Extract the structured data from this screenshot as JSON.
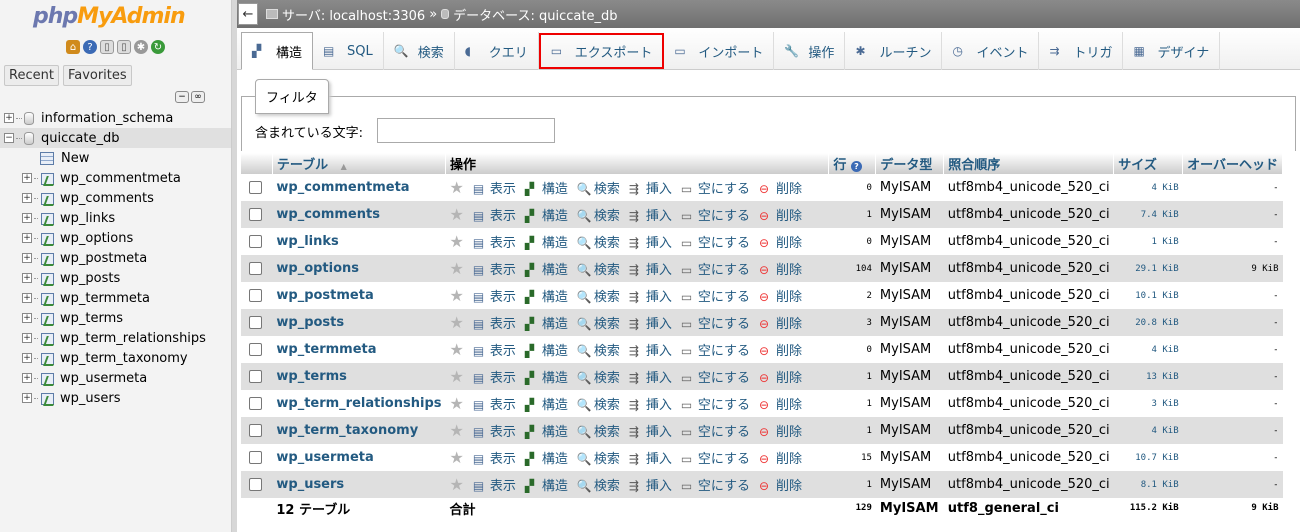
{
  "app": {
    "logo_php": "php",
    "logo_my": "MyAdmin"
  },
  "nav": {
    "recent": "Recent",
    "favorites": "Favorites",
    "tree": [
      "information_schema",
      "quiccate_db",
      "New",
      "wp_commentmeta",
      "wp_comments",
      "wp_links",
      "wp_options",
      "wp_postmeta",
      "wp_posts",
      "wp_termmeta",
      "wp_terms",
      "wp_term_relationships",
      "wp_term_taxonomy",
      "wp_usermeta",
      "wp_users"
    ]
  },
  "breadcrumb": {
    "server": "サーバ: localhost:3306",
    "sep": "»",
    "database": "データベース: quiccate_db"
  },
  "tabs": [
    "構造",
    "SQL",
    "検索",
    "クエリ",
    "エクスポート",
    "インポート",
    "操作",
    "ルーチン",
    "イベント",
    "トリガ",
    "デザイナ"
  ],
  "filter": {
    "title": "フィルタ",
    "label": "含まれている文字:",
    "value": ""
  },
  "table": {
    "headers": [
      "テーブル",
      "操作",
      "行",
      "データ型",
      "照合順序",
      "サイズ",
      "オーバーヘッド"
    ],
    "sort_arrow": "▲",
    "actions": [
      "表示",
      "構造",
      "検索",
      "挿入",
      "空にする",
      "削除"
    ],
    "rows": [
      {
        "name": "wp_commentmeta",
        "rows": "0",
        "type": "MyISAM",
        "collation": "utf8mb4_unicode_520_ci",
        "size": "4 KiB",
        "overhead": "-"
      },
      {
        "name": "wp_comments",
        "rows": "1",
        "type": "MyISAM",
        "collation": "utf8mb4_unicode_520_ci",
        "size": "7.4 KiB",
        "overhead": "-"
      },
      {
        "name": "wp_links",
        "rows": "0",
        "type": "MyISAM",
        "collation": "utf8mb4_unicode_520_ci",
        "size": "1 KiB",
        "overhead": "-"
      },
      {
        "name": "wp_options",
        "rows": "104",
        "type": "MyISAM",
        "collation": "utf8mb4_unicode_520_ci",
        "size": "29.1 KiB",
        "overhead": "9 KiB"
      },
      {
        "name": "wp_postmeta",
        "rows": "2",
        "type": "MyISAM",
        "collation": "utf8mb4_unicode_520_ci",
        "size": "10.1 KiB",
        "overhead": "-"
      },
      {
        "name": "wp_posts",
        "rows": "3",
        "type": "MyISAM",
        "collation": "utf8mb4_unicode_520_ci",
        "size": "20.8 KiB",
        "overhead": "-"
      },
      {
        "name": "wp_termmeta",
        "rows": "0",
        "type": "MyISAM",
        "collation": "utf8mb4_unicode_520_ci",
        "size": "4 KiB",
        "overhead": "-"
      },
      {
        "name": "wp_terms",
        "rows": "1",
        "type": "MyISAM",
        "collation": "utf8mb4_unicode_520_ci",
        "size": "13 KiB",
        "overhead": "-"
      },
      {
        "name": "wp_term_relationships",
        "rows": "1",
        "type": "MyISAM",
        "collation": "utf8mb4_unicode_520_ci",
        "size": "3 KiB",
        "overhead": "-"
      },
      {
        "name": "wp_term_taxonomy",
        "rows": "1",
        "type": "MyISAM",
        "collation": "utf8mb4_unicode_520_ci",
        "size": "4 KiB",
        "overhead": "-"
      },
      {
        "name": "wp_usermeta",
        "rows": "15",
        "type": "MyISAM",
        "collation": "utf8mb4_unicode_520_ci",
        "size": "10.7 KiB",
        "overhead": "-"
      },
      {
        "name": "wp_users",
        "rows": "1",
        "type": "MyISAM",
        "collation": "utf8mb4_unicode_520_ci",
        "size": "8.1 KiB",
        "overhead": "-"
      }
    ],
    "footer": {
      "count": "12 テーブル",
      "label": "合計",
      "rows": "129",
      "type": "MyISAM",
      "collation": "utf8_general_ci",
      "size": "115.2 KiB",
      "overhead": "9 KiB"
    }
  }
}
